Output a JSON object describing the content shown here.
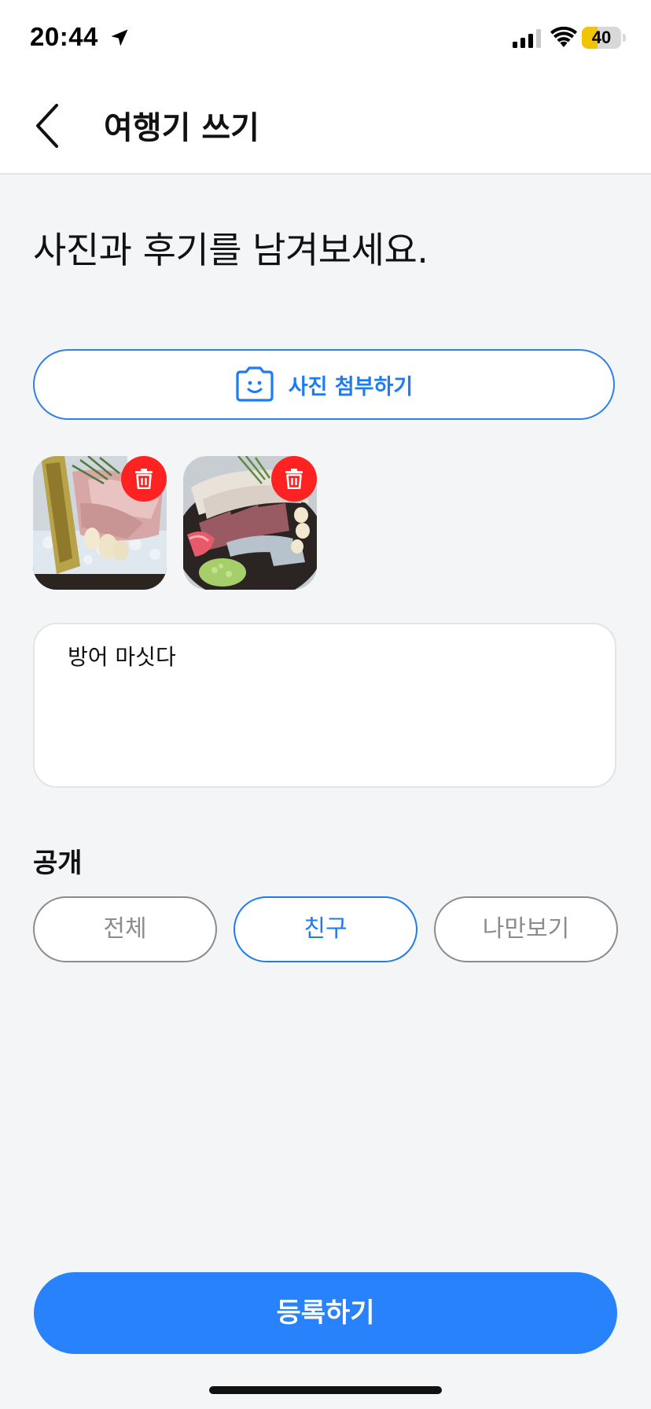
{
  "status_bar": {
    "time": "20:44",
    "battery_level": "40",
    "battery_fraction": 0.4,
    "battery_color": "#f2c400",
    "icons": [
      "location-arrow-icon",
      "cellular-signal-icon",
      "wifi-icon",
      "battery-icon"
    ]
  },
  "nav": {
    "back_icon": "chevron-left-icon",
    "title": "여행기 쓰기"
  },
  "main": {
    "heading": "사진과 후기를 남겨보세요.",
    "attach_button": {
      "icon": "camera-smile-icon",
      "label": "사진 첨부하기"
    },
    "photos": [
      {
        "name": "photo-sashimi-1",
        "delete_icon": "trash-icon"
      },
      {
        "name": "photo-sashimi-2",
        "delete_icon": "trash-icon"
      }
    ],
    "review": {
      "value": "방어 마싯다"
    },
    "visibility": {
      "label": "공개",
      "options": [
        "전체",
        "친구",
        "나만보기"
      ],
      "selected": "친구"
    },
    "submit_label": "등록하기"
  },
  "colors": {
    "accent": "#1e7cf2",
    "submit": "#2782fb",
    "delete": "#ff2222",
    "background": "#f4f5f7"
  }
}
